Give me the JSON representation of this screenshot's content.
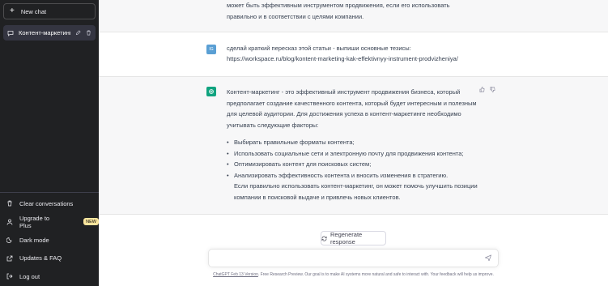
{
  "sidebar": {
    "new_chat": "New chat",
    "conversation": "Контент-маркетинг ка",
    "bottom_items": [
      {
        "label": "Clear conversations",
        "icon": "trash-icon"
      },
      {
        "label": "Upgrade to Plus",
        "icon": "user-icon",
        "badge": "NEW"
      },
      {
        "label": "Dark mode",
        "icon": "moon-icon"
      },
      {
        "label": "Updates & FAQ",
        "icon": "external-link-icon"
      },
      {
        "label": "Log out",
        "icon": "logout-icon"
      }
    ]
  },
  "messages": {
    "prev_assistant": {
      "lines": [
        "может быть эффективным инструментом продвижения, если его использовать",
        "правильно и в соответствии с целями компании."
      ]
    },
    "user": {
      "avatar": "IG",
      "lines": [
        "сделай краткий пересказ этой статьи - выпиши основные тезисы:",
        "https://workspace.ru/blog/kontent-marketing-kak-effektivnyy-instrument-prodvizheniya/"
      ]
    },
    "assistant": {
      "paragraph": "Контент-маркетинг - это эффективный инструмент продвижения бизнеса, который предполагает создание качественного контента, который будет интересным и полезным для целевой аудитории. Для достижения успеха в контент-маркетинге необходимо учитывать следующие факторы:",
      "bullets": [
        "Выбирать правильные форматы контента;",
        "Использовать социальные сети и электронную почту для продвижения контента;",
        "Оптимизировать контент для поисковых систем;",
        "Анализировать эффективность контента и вносить изменения в стратегию."
      ],
      "closing": "Если правильно использовать контент-маркетинг, он может помочь улучшить позиции компании в поисковой выдаче и привлечь новых клиентов."
    }
  },
  "regenerate_label": "Regenerate response",
  "input": {
    "placeholder": "",
    "value": ""
  },
  "footer": {
    "link": "ChatGPT Feb 13 Version",
    "text": ". Free Research Preview. Our goal is to make AI systems more natural and safe to interact with. Your feedback will help us improve."
  },
  "colors": {
    "sidebar": "#202123",
    "accent": "#10a37f",
    "user_avatar": "#5a9fd4"
  }
}
